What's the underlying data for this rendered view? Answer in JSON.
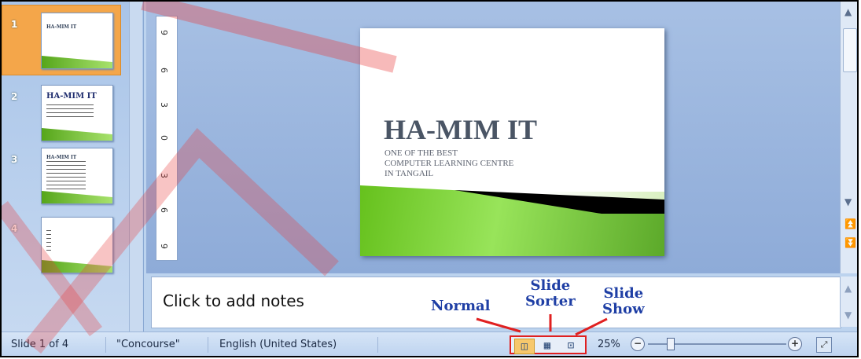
{
  "thumbnails": [
    {
      "number": "1",
      "title": "HA-MIM IT"
    },
    {
      "number": "2",
      "title": "HA-MIM IT"
    },
    {
      "number": "3",
      "title": "HA-MIM IT"
    },
    {
      "number": "4",
      "title": ""
    }
  ],
  "ruler": {
    "ticks": [
      "9",
      "6",
      "3",
      "0",
      "3",
      "6",
      "9"
    ]
  },
  "slide": {
    "title": "HA-MIM IT",
    "subtitle_lines": [
      "ONE OF THE BEST",
      "COMPUTER LEARNING CENTRE",
      "IN TANGAIL"
    ]
  },
  "notes": {
    "placeholder": "Click to add notes"
  },
  "status": {
    "slide_info": "Slide 1 of 4",
    "theme": "\"Concourse\"",
    "language": "English (United States)",
    "zoom": "25%"
  },
  "annotations": {
    "normal": "Normal",
    "slide_sorter_1": "Slide",
    "slide_sorter_2": "Sorter",
    "slide_show_1": "Slide",
    "slide_show_2": "Show"
  },
  "icons": {
    "normal_view": "normal-view-icon",
    "slide_sorter_view": "slide-sorter-icon",
    "slide_show_view": "slide-show-icon",
    "zoom_out": "zoom-out-icon",
    "zoom_in": "zoom-in-icon",
    "fit_window": "fit-window-icon"
  },
  "colors": {
    "accent_red": "#e02020",
    "annotation_blue": "#1f3fa5",
    "active_thumb": "#f4a64a"
  }
}
